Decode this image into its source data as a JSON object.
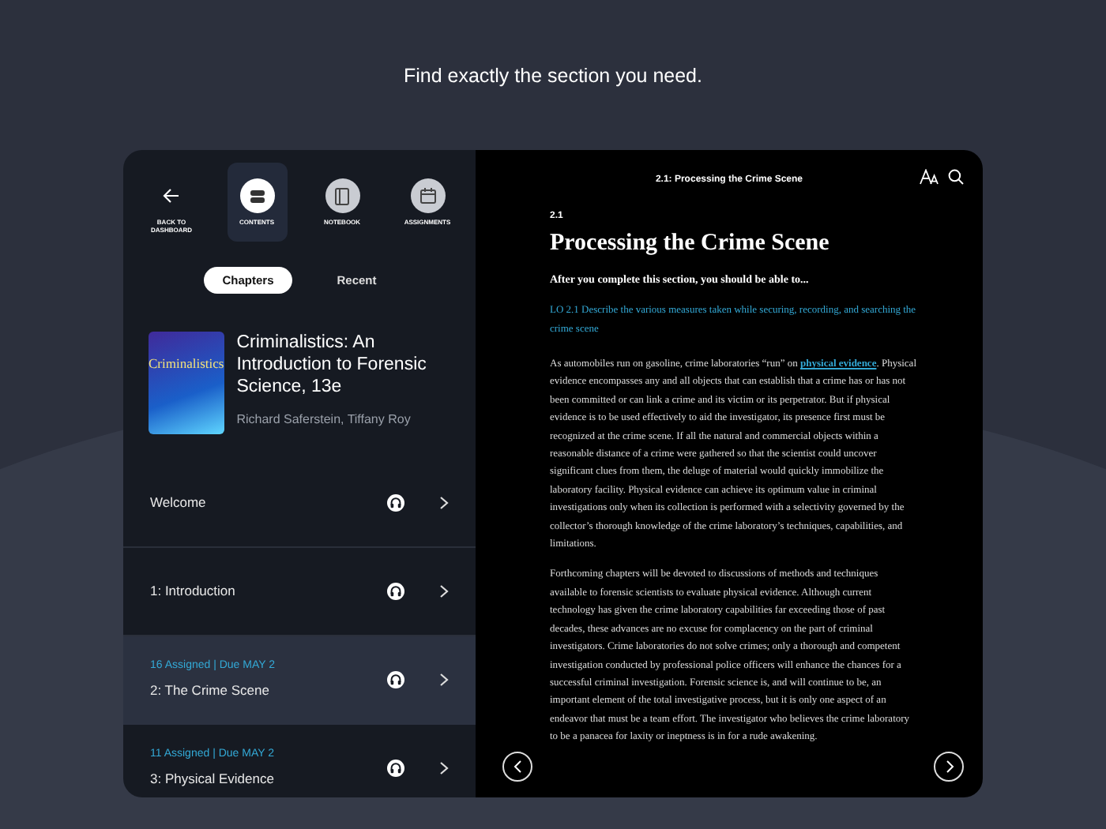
{
  "headline": "Find exactly the section you need.",
  "nav": [
    {
      "kind": "back",
      "label": "BACK TO DASHBOARD",
      "selected": false
    },
    {
      "kind": "contents",
      "label": "CONTENTS",
      "selected": true
    },
    {
      "kind": "notebook",
      "label": "NOTEBOOK",
      "selected": false
    },
    {
      "kind": "assignments",
      "label": "ASSIGNMENTS",
      "selected": false
    }
  ],
  "tabs": [
    {
      "label": "Chapters",
      "selected": true
    },
    {
      "label": "Recent",
      "selected": false
    }
  ],
  "book": {
    "title": "Criminalistics: An Introduction to Forensic Science, 13e",
    "authors": "Richard Saferstein, Tiffany Roy",
    "cover_title": "Criminalistics"
  },
  "chapters": [
    {
      "title": "Welcome",
      "selected": false
    },
    {
      "title": "1: Introduction",
      "selected": false
    },
    {
      "assigned": "16 Assigned | Due MAY 2",
      "title": "2: The Crime Scene",
      "selected": true
    },
    {
      "assigned": "11 Assigned | Due MAY 2",
      "title": "3: Physical Evidence",
      "selected": false
    }
  ],
  "reader": {
    "header": "2.1: Processing the Crime Scene",
    "section_number": "2.1",
    "title": "Processing the Crime Scene",
    "intro": "After you complete this section, you should be able to...",
    "objective": "LO 2.1 Describe the various measures taken while securing, recording, and searching the crime scene",
    "paragraphs": [
      [
        {
          "kind": "text",
          "text": "As automobiles run on gasoline, crime laboratories “run” on "
        },
        {
          "kind": "link",
          "text": "physical evidence"
        },
        {
          "kind": "text",
          "text": ". Physical evidence encompasses any and all objects that can establish that a crime has or has not been committed or can link a crime and its victim or its perpetrator. But if physical evidence is to be used effectively to aid the investigator, its presence first must be recognized at the crime scene. If all the natural and commercial objects within a reasonable distance of a crime were gathered so that the scientist could uncover significant clues from them, the deluge of material would quickly immobilize the laboratory facility. Physical evidence can achieve its optimum value in criminal investigations only when its collection is performed with a selectivity governed by the collector’s thorough knowledge of the crime laboratory’s techniques, capabilities, and limitations."
        }
      ],
      [
        {
          "kind": "text",
          "text": "Forthcoming chapters will be devoted to discussions of methods and techniques available to forensic scientists to evaluate physical evidence. Although current technology has given the crime laboratory capabilities far exceeding those of past decades, these advances are no excuse for complacency on the part of criminal investigators. Crime laboratories do not solve crimes; only a thorough and competent investigation conducted by professional police officers will enhance the chances for a successful criminal investigation. Forensic science is, and will continue to be, an important element of the total investigative process, but it is only one aspect of an endeavor that must be a team effort. The investigator who believes the crime laboratory to be a panacea for laxity or ineptness is in for a rude awakening."
        }
      ]
    ]
  }
}
